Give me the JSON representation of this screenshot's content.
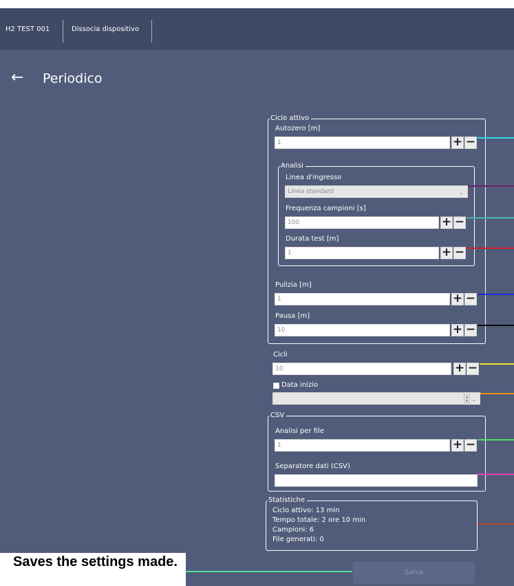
{
  "header": {
    "tabs": [
      {
        "label": "H2 TEST 001"
      },
      {
        "label": "Dissocia dispositivo"
      }
    ]
  },
  "page": {
    "back_icon": "arrow-left-icon",
    "title": "Periodico"
  },
  "ciclo_attivo": {
    "legend": "Ciclo attivo",
    "autozero": {
      "label": "Autozero [m]",
      "value": "1"
    },
    "analisi": {
      "legend": "Analisi",
      "linea": {
        "label": "Linea d'ingresso",
        "value": "Linea standard"
      },
      "frequenza": {
        "label": "Frequenza campioni [s]",
        "value": "100"
      },
      "durata": {
        "label": "Durata test [m]",
        "value": "1"
      }
    },
    "pulizia": {
      "label": "Pulizia [m]",
      "value": "1"
    },
    "pausa": {
      "label": "Pausa [m]",
      "value": "10"
    }
  },
  "cicli": {
    "label": "Cicli",
    "value": "10"
  },
  "data_inizio": {
    "label": "Data inizio",
    "checked": false,
    "value": ""
  },
  "csv": {
    "legend": "CSV",
    "analisi_per_file": {
      "label": "Analisi per file",
      "value": "1"
    },
    "separatore": {
      "label": "Separatore dati (CSV)",
      "value": ""
    }
  },
  "statistiche": {
    "legend": "Statistiche",
    "lines": [
      "Ciclo attivo: 13 min",
      "Tempo totale: 2 ore 10 min",
      "Campioni: 6",
      "File generati: 0"
    ]
  },
  "buttons": {
    "plus": "+",
    "minus": "−",
    "save": "Salva"
  },
  "annotation": {
    "text": "Saves the settings made."
  },
  "colors": {
    "topbar": "#3f4a66",
    "background": "#515c7a",
    "autozero": "#33d6ee",
    "linea": "#6b1f6b",
    "frequenza": "#4fb5a8",
    "durata": "#d21f2a",
    "pulizia": "#1f2be0",
    "pausa": "#000000",
    "cicli": "#e8e81a",
    "data_inizio": "#f08f1a",
    "analisi_per_file": "#55df55",
    "separatore": "#ee3fb6",
    "statistiche": "#b8452e",
    "annotation": "#56e29c"
  }
}
